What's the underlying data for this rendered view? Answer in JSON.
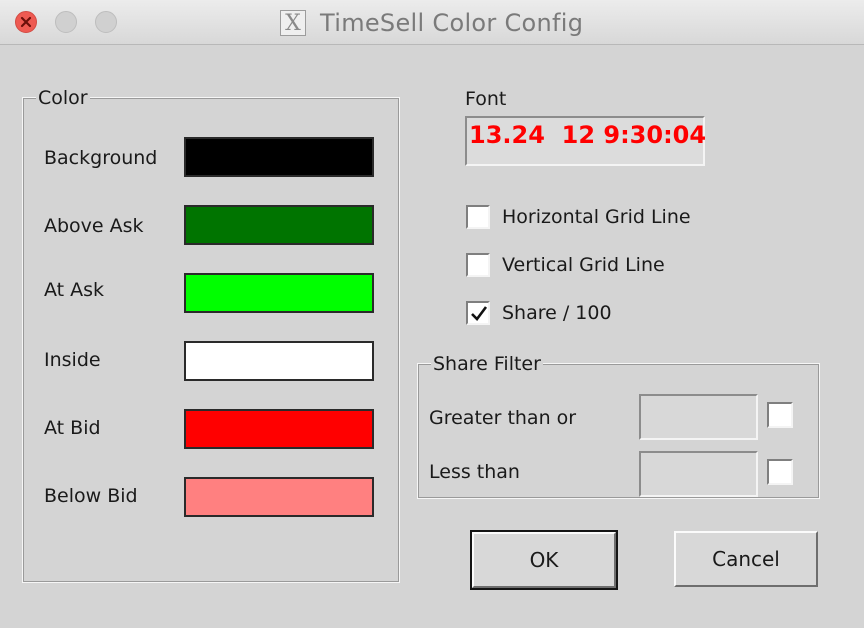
{
  "window": {
    "title": "TimeSell Color Config",
    "app_icon": "x-window-icon"
  },
  "color_group": {
    "legend": "Color",
    "items": [
      {
        "label": "Background",
        "color": "#000000"
      },
      {
        "label": "Above Ask",
        "color": "#007400"
      },
      {
        "label": "At Ask",
        "color": "#00ff00"
      },
      {
        "label": "Inside",
        "color": "#ffffff"
      },
      {
        "label": "At Bid",
        "color": "#ff0000"
      },
      {
        "label": "Below Bid",
        "color": "#ff8080"
      }
    ]
  },
  "font": {
    "label": "Font",
    "preview_text": "13.24  12 9:30:04",
    "preview_color": "#ff0000"
  },
  "options": {
    "horizontal_grid": {
      "label": "Horizontal Grid Line",
      "checked": false
    },
    "vertical_grid": {
      "label": "Vertical Grid Line",
      "checked": false
    },
    "share_100": {
      "label": "Share / 100",
      "checked": true
    }
  },
  "share_filter": {
    "legend": "Share Filter",
    "greater": {
      "label": "Greater than or",
      "value": "",
      "checked": false
    },
    "less": {
      "label": "Less than",
      "value": "",
      "checked": false
    }
  },
  "buttons": {
    "ok": "OK",
    "cancel": "Cancel"
  }
}
